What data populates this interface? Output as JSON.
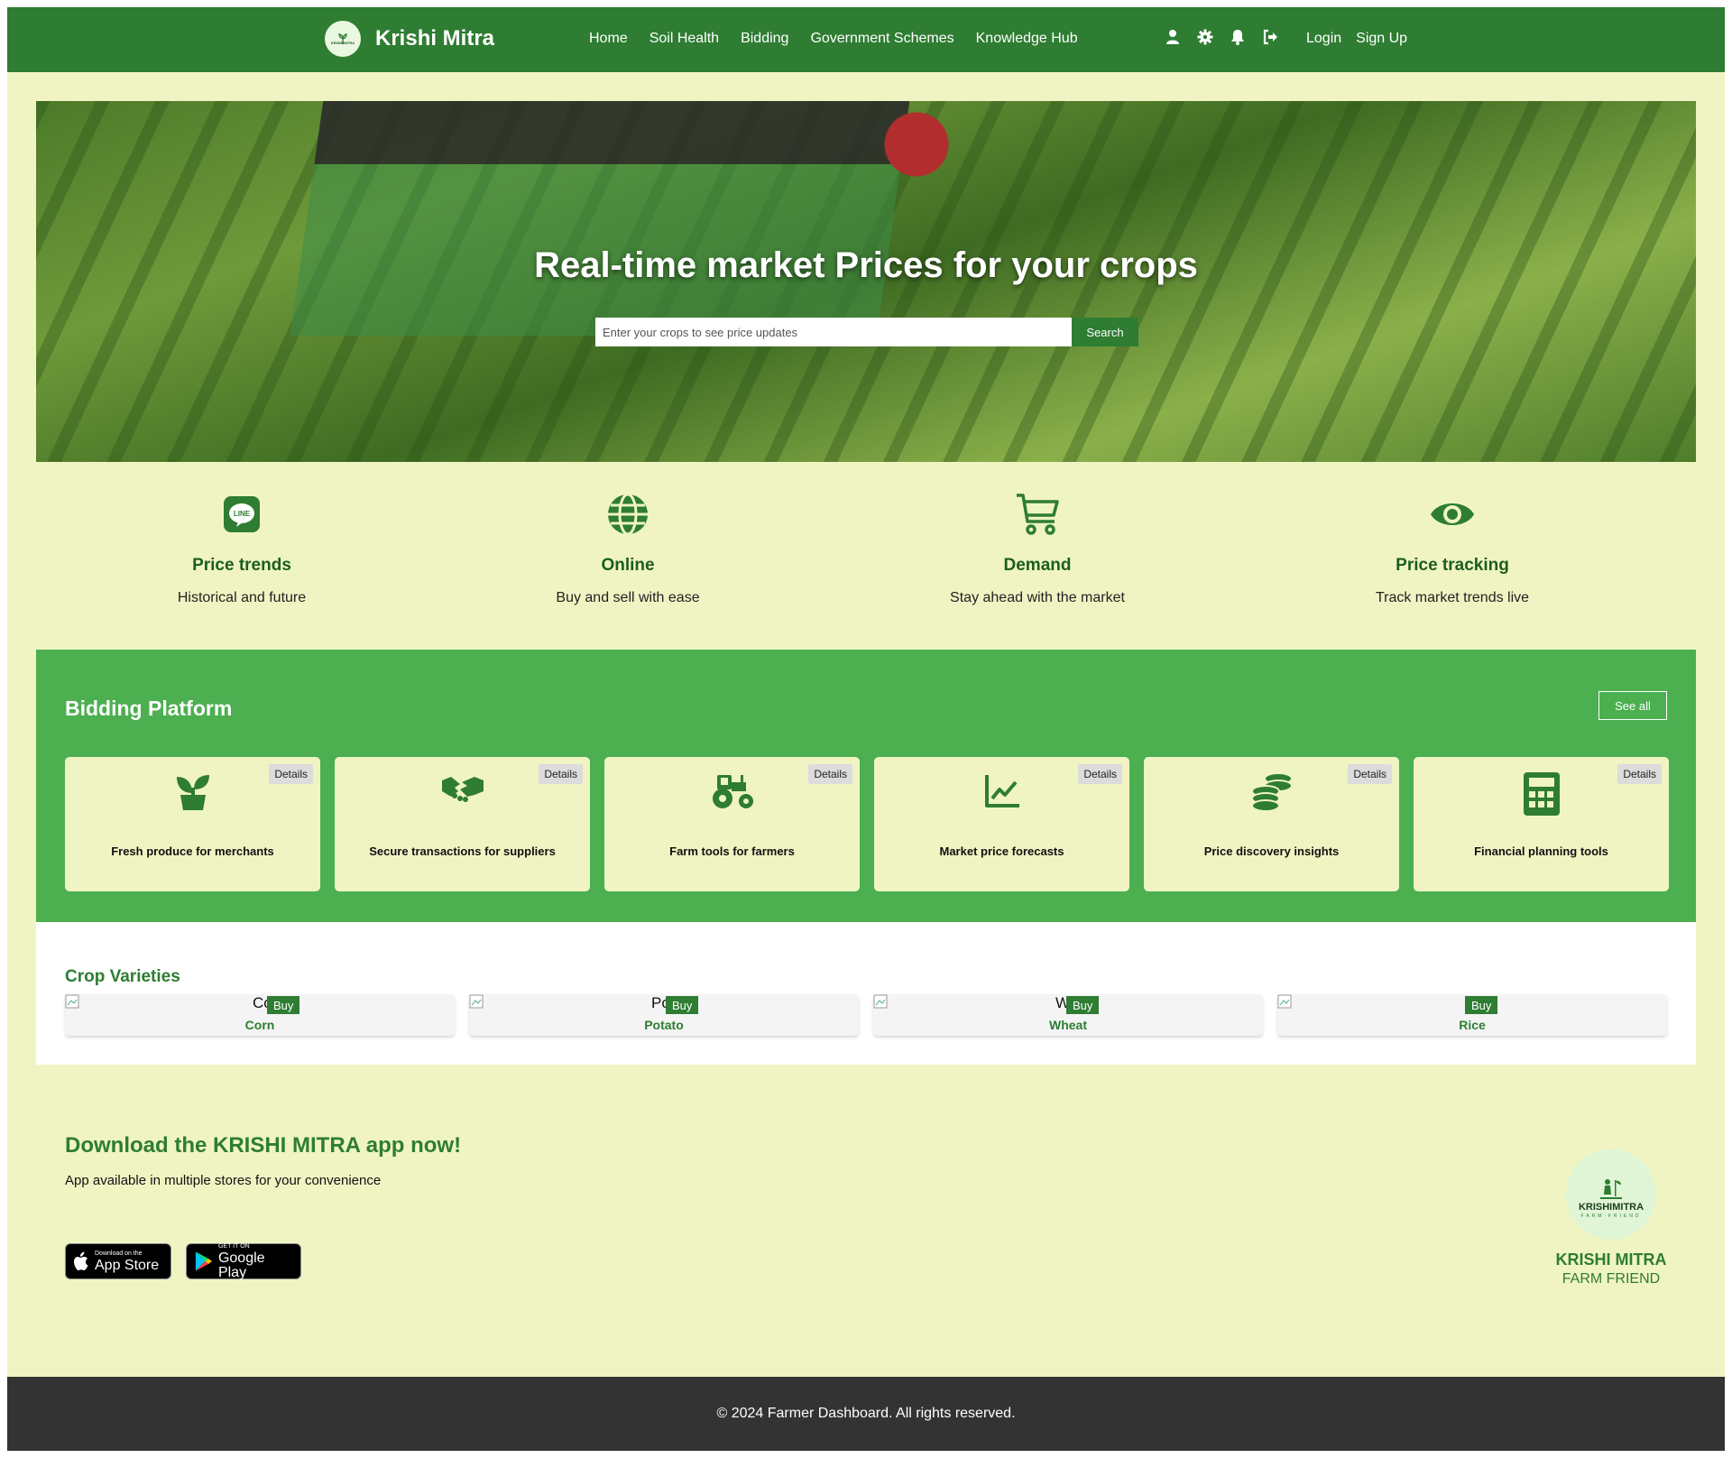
{
  "nav": {
    "brand": "Krishi Mitra",
    "logo_text": "KRISHIMITRA",
    "links": [
      "Home",
      "Soil Health",
      "Bidding",
      "Government Schemes",
      "Knowledge Hub"
    ],
    "icons": [
      "user-icon",
      "gear-icon",
      "bell-icon",
      "logout-icon"
    ],
    "login": "Login",
    "signup": "Sign Up"
  },
  "hero": {
    "title": "Real-time market Prices for your crops",
    "search_placeholder": "Enter your crops to see price updates",
    "search_button": "Search"
  },
  "features": [
    {
      "icon": "line-chat-icon",
      "icon_text": "LINE",
      "title": "Price trends",
      "subtitle": "Historical and future"
    },
    {
      "icon": "globe-icon",
      "title": "Online",
      "subtitle": "Buy and sell with ease"
    },
    {
      "icon": "cart-icon",
      "title": "Demand",
      "subtitle": "Stay ahead with the market"
    },
    {
      "icon": "eye-icon",
      "title": "Price tracking",
      "subtitle": "Track market trends live"
    }
  ],
  "bidding": {
    "title": "Bidding Platform",
    "see_all": "See all",
    "details_label": "Details",
    "cards": [
      {
        "icon": "seedling-icon",
        "text": "Fresh produce for merchants"
      },
      {
        "icon": "handshake-icon",
        "text": "Secure transactions for suppliers"
      },
      {
        "icon": "tractor-icon",
        "text": "Farm tools for farmers"
      },
      {
        "icon": "chart-line-icon",
        "text": "Market price forecasts"
      },
      {
        "icon": "coins-icon",
        "text": "Price discovery insights"
      },
      {
        "icon": "calculator-icon",
        "text": "Financial planning tools"
      }
    ]
  },
  "crops": {
    "title": "Crop Varieties",
    "buy_label": "Buy",
    "items": [
      {
        "name": "Corn",
        "alt_clip": "Co"
      },
      {
        "name": "Potato",
        "alt_clip": "Po"
      },
      {
        "name": "Wheat",
        "alt_clip": "W"
      },
      {
        "name": "Rice",
        "alt_clip": ""
      }
    ]
  },
  "app": {
    "title": "Download the KRISHI MITRA app now!",
    "subtitle": "App available in multiple stores for your convenience",
    "appstore_small": "Download on the",
    "appstore_big": "App Store",
    "googleplay_small": "GET IT ON",
    "googleplay_big": "Google Play",
    "logo_title": "KRISHIMITRA",
    "logo_sub": "FARM FRIEND",
    "brand_name": "KRISHI MITRA",
    "brand_tagline": "FARM FRIEND"
  },
  "footer": {
    "text": "© 2024 Farmer Dashboard. All rights reserved."
  },
  "colors": {
    "nav_green": "#2e7d32",
    "page_bg": "#f0f4c3",
    "bidding_green": "#4caf50",
    "dark_green_text": "#1b5e20",
    "footer_bg": "#333333"
  }
}
